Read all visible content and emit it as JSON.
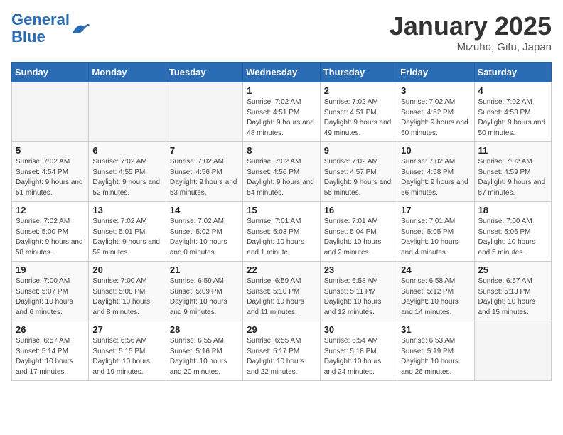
{
  "header": {
    "logo_line1": "General",
    "logo_line2": "Blue",
    "month": "January 2025",
    "location": "Mizuho, Gifu, Japan"
  },
  "weekdays": [
    "Sunday",
    "Monday",
    "Tuesday",
    "Wednesday",
    "Thursday",
    "Friday",
    "Saturday"
  ],
  "weeks": [
    {
      "days": [
        {
          "num": "",
          "info": ""
        },
        {
          "num": "",
          "info": ""
        },
        {
          "num": "",
          "info": ""
        },
        {
          "num": "1",
          "info": "Sunrise: 7:02 AM\nSunset: 4:51 PM\nDaylight: 9 hours\nand 48 minutes."
        },
        {
          "num": "2",
          "info": "Sunrise: 7:02 AM\nSunset: 4:51 PM\nDaylight: 9 hours\nand 49 minutes."
        },
        {
          "num": "3",
          "info": "Sunrise: 7:02 AM\nSunset: 4:52 PM\nDaylight: 9 hours\nand 50 minutes."
        },
        {
          "num": "4",
          "info": "Sunrise: 7:02 AM\nSunset: 4:53 PM\nDaylight: 9 hours\nand 50 minutes."
        }
      ]
    },
    {
      "days": [
        {
          "num": "5",
          "info": "Sunrise: 7:02 AM\nSunset: 4:54 PM\nDaylight: 9 hours\nand 51 minutes."
        },
        {
          "num": "6",
          "info": "Sunrise: 7:02 AM\nSunset: 4:55 PM\nDaylight: 9 hours\nand 52 minutes."
        },
        {
          "num": "7",
          "info": "Sunrise: 7:02 AM\nSunset: 4:56 PM\nDaylight: 9 hours\nand 53 minutes."
        },
        {
          "num": "8",
          "info": "Sunrise: 7:02 AM\nSunset: 4:56 PM\nDaylight: 9 hours\nand 54 minutes."
        },
        {
          "num": "9",
          "info": "Sunrise: 7:02 AM\nSunset: 4:57 PM\nDaylight: 9 hours\nand 55 minutes."
        },
        {
          "num": "10",
          "info": "Sunrise: 7:02 AM\nSunset: 4:58 PM\nDaylight: 9 hours\nand 56 minutes."
        },
        {
          "num": "11",
          "info": "Sunrise: 7:02 AM\nSunset: 4:59 PM\nDaylight: 9 hours\nand 57 minutes."
        }
      ]
    },
    {
      "days": [
        {
          "num": "12",
          "info": "Sunrise: 7:02 AM\nSunset: 5:00 PM\nDaylight: 9 hours\nand 58 minutes."
        },
        {
          "num": "13",
          "info": "Sunrise: 7:02 AM\nSunset: 5:01 PM\nDaylight: 9 hours\nand 59 minutes."
        },
        {
          "num": "14",
          "info": "Sunrise: 7:02 AM\nSunset: 5:02 PM\nDaylight: 10 hours\nand 0 minutes."
        },
        {
          "num": "15",
          "info": "Sunrise: 7:01 AM\nSunset: 5:03 PM\nDaylight: 10 hours\nand 1 minute."
        },
        {
          "num": "16",
          "info": "Sunrise: 7:01 AM\nSunset: 5:04 PM\nDaylight: 10 hours\nand 2 minutes."
        },
        {
          "num": "17",
          "info": "Sunrise: 7:01 AM\nSunset: 5:05 PM\nDaylight: 10 hours\nand 4 minutes."
        },
        {
          "num": "18",
          "info": "Sunrise: 7:00 AM\nSunset: 5:06 PM\nDaylight: 10 hours\nand 5 minutes."
        }
      ]
    },
    {
      "days": [
        {
          "num": "19",
          "info": "Sunrise: 7:00 AM\nSunset: 5:07 PM\nDaylight: 10 hours\nand 6 minutes."
        },
        {
          "num": "20",
          "info": "Sunrise: 7:00 AM\nSunset: 5:08 PM\nDaylight: 10 hours\nand 8 minutes."
        },
        {
          "num": "21",
          "info": "Sunrise: 6:59 AM\nSunset: 5:09 PM\nDaylight: 10 hours\nand 9 minutes."
        },
        {
          "num": "22",
          "info": "Sunrise: 6:59 AM\nSunset: 5:10 PM\nDaylight: 10 hours\nand 11 minutes."
        },
        {
          "num": "23",
          "info": "Sunrise: 6:58 AM\nSunset: 5:11 PM\nDaylight: 10 hours\nand 12 minutes."
        },
        {
          "num": "24",
          "info": "Sunrise: 6:58 AM\nSunset: 5:12 PM\nDaylight: 10 hours\nand 14 minutes."
        },
        {
          "num": "25",
          "info": "Sunrise: 6:57 AM\nSunset: 5:13 PM\nDaylight: 10 hours\nand 15 minutes."
        }
      ]
    },
    {
      "days": [
        {
          "num": "26",
          "info": "Sunrise: 6:57 AM\nSunset: 5:14 PM\nDaylight: 10 hours\nand 17 minutes."
        },
        {
          "num": "27",
          "info": "Sunrise: 6:56 AM\nSunset: 5:15 PM\nDaylight: 10 hours\nand 19 minutes."
        },
        {
          "num": "28",
          "info": "Sunrise: 6:55 AM\nSunset: 5:16 PM\nDaylight: 10 hours\nand 20 minutes."
        },
        {
          "num": "29",
          "info": "Sunrise: 6:55 AM\nSunset: 5:17 PM\nDaylight: 10 hours\nand 22 minutes."
        },
        {
          "num": "30",
          "info": "Sunrise: 6:54 AM\nSunset: 5:18 PM\nDaylight: 10 hours\nand 24 minutes."
        },
        {
          "num": "31",
          "info": "Sunrise: 6:53 AM\nSunset: 5:19 PM\nDaylight: 10 hours\nand 26 minutes."
        },
        {
          "num": "",
          "info": ""
        }
      ]
    }
  ]
}
